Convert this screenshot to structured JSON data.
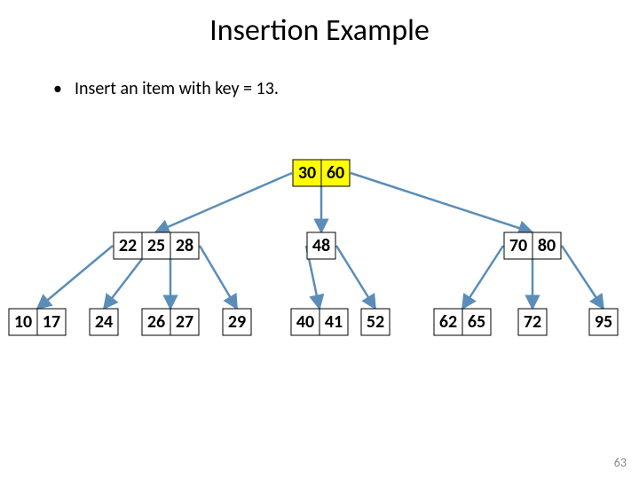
{
  "title": "Insertion Example",
  "bullet": "Insert an item with key = 13.",
  "page_number": "63",
  "tree": {
    "root": {
      "keys": [
        "30",
        "60"
      ],
      "highlight": [
        true,
        true
      ]
    },
    "level1": [
      {
        "keys": [
          "22",
          "25",
          "28"
        ]
      },
      {
        "keys": [
          "48"
        ]
      },
      {
        "keys": [
          "70",
          "80"
        ]
      }
    ],
    "level2": [
      {
        "keys": [
          "10",
          "17"
        ]
      },
      {
        "keys": [
          "24"
        ]
      },
      {
        "keys": [
          "26",
          "27"
        ]
      },
      {
        "keys": [
          "29"
        ]
      },
      {
        "keys": [
          "40",
          "41"
        ]
      },
      {
        "keys": [
          "52"
        ]
      },
      {
        "keys": [
          "62",
          "65"
        ]
      },
      {
        "keys": [
          "72"
        ]
      },
      {
        "keys": [
          "95"
        ]
      }
    ]
  }
}
